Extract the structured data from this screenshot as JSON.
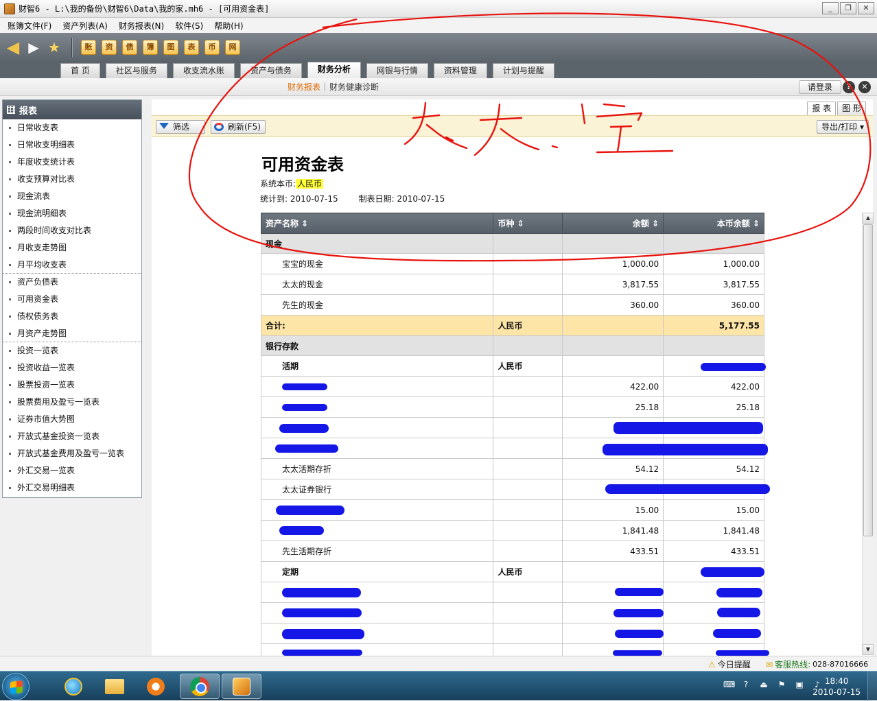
{
  "window": {
    "title": "财智6 - L:\\我的备份\\财智6\\Data\\我的家.mh6 - [可用资金表]",
    "buttons": [
      "_",
      "❐",
      "✕"
    ]
  },
  "menu": [
    "账簿文件(F)",
    "资产列表(A)",
    "财务报表(N)",
    "软件(S)",
    "帮助(H)"
  ],
  "toolbar": {
    "icons": [
      "back-arrow-icon",
      "forward-arrow-icon",
      "favorite-star-icon"
    ],
    "app_icons": [
      "账",
      "资",
      "债",
      "簿",
      "图",
      "表",
      "币",
      "网"
    ]
  },
  "tabs": [
    "首 页",
    "社区与服务",
    "收支流水账",
    "资产与债务",
    "财务分析",
    "网银与行情",
    "资料管理",
    "计划与提醒"
  ],
  "active_tab": "财务分析",
  "subtabs": [
    "财务报表",
    "财务健康诊断"
  ],
  "login_label": "请登录",
  "help_glyph": "?",
  "close_glyph": "✕",
  "sidebar": {
    "title": "报表",
    "items": [
      "日常收支表",
      "日常收支明细表",
      "年度收支统计表",
      "收支预算对比表",
      "现金流表",
      "现金流明细表",
      "两段时间收支对比表",
      "月收支走势图",
      "月平均收支表",
      "资产负债表",
      "可用资金表",
      "债权债务表",
      "月资产走势图",
      "投资一览表",
      "投资收益一览表",
      "股票投资一览表",
      "股票费用及盈亏一览表",
      "证券市值大势图",
      "开放式基金投资一览表",
      "开放式基金费用及盈亏一览表",
      "外汇交易一览表",
      "外汇交易明细表"
    ]
  },
  "view_tabs": [
    "报 表",
    "图 形"
  ],
  "filter_label": "筛选",
  "refresh_label": "刷新(F5)",
  "export_label": "导出/打印 ▾",
  "report": {
    "title": "可用资金表",
    "currency_label": "系统本币:",
    "currency_value": "人民币",
    "stat_label": "统计到:",
    "stat_date": "2010-07-15",
    "made_label": "制表日期:",
    "made_date": "2010-07-15",
    "columns": [
      "资产名称 ⇕",
      "币种 ⇕",
      "余额 ⇕",
      "本币余额 ⇕"
    ],
    "rows": [
      {
        "type": "group",
        "name": "现金",
        "currency": "",
        "balance": "",
        "base": ""
      },
      {
        "type": "item",
        "name": "宝宝的现金",
        "currency": "",
        "balance": "1,000.00",
        "base": "1,000.00"
      },
      {
        "type": "item",
        "name": "太太的现金",
        "currency": "",
        "balance": "3,817.55",
        "base": "3,817.55"
      },
      {
        "type": "item",
        "name": "先生的现金",
        "currency": "",
        "balance": "360.00",
        "base": "360.00"
      },
      {
        "type": "total",
        "name": "合计:",
        "currency": "人民币",
        "balance": "",
        "base": "5,177.55"
      },
      {
        "type": "group",
        "name": "银行存款",
        "currency": "",
        "balance": "",
        "base": ""
      },
      {
        "type": "sub",
        "name": "活期",
        "currency": "人民币",
        "balance": "",
        "base": ""
      },
      {
        "type": "item",
        "name": "",
        "currency": "",
        "balance": "422.00",
        "base": "422.00"
      },
      {
        "type": "item",
        "name": "",
        "currency": "",
        "balance": "25.18",
        "base": "25.18"
      },
      {
        "type": "item",
        "name": "",
        "currency": "",
        "balance": "",
        "base": ""
      },
      {
        "type": "item",
        "name": "",
        "currency": "",
        "balance": "",
        "base": ""
      },
      {
        "type": "item",
        "name": "太太活期存折",
        "currency": "",
        "balance": "54.12",
        "base": "54.12"
      },
      {
        "type": "item",
        "name": "太太证券银行",
        "currency": "",
        "balance": "",
        "base": ""
      },
      {
        "type": "item",
        "name": "",
        "currency": "",
        "balance": "15.00",
        "base": "15.00"
      },
      {
        "type": "item",
        "name": "",
        "currency": "",
        "balance": "1,841.48",
        "base": "1,841.48"
      },
      {
        "type": "item",
        "name": "先生活期存折",
        "currency": "",
        "balance": "433.51",
        "base": "433.51"
      },
      {
        "type": "sub",
        "name": "定期",
        "currency": "人民币",
        "balance": "",
        "base": ""
      },
      {
        "type": "item",
        "name": "",
        "currency": "",
        "balance": "",
        "base": ""
      },
      {
        "type": "item",
        "name": "",
        "currency": "",
        "balance": "",
        "base": ""
      },
      {
        "type": "item",
        "name": "",
        "currency": "",
        "balance": "",
        "base": ""
      },
      {
        "type": "item",
        "name": "",
        "currency": "",
        "balance": "",
        "base": ""
      }
    ]
  },
  "annotation_text": "太太 . 空",
  "status": {
    "reminder": "今日提醒",
    "hotline_label": "客服热线:",
    "hotline": "028-87016666"
  },
  "taskbar": {
    "time": "18:40",
    "date": "2010-07-15"
  },
  "colors": {
    "toolbar_bg": "#5b636b",
    "active_subtab": "#e06b00",
    "total_row": "#fde5a8",
    "currency_highlight": "#ffff3a",
    "redaction": "#1417e6",
    "annotation": "#e8120c"
  }
}
